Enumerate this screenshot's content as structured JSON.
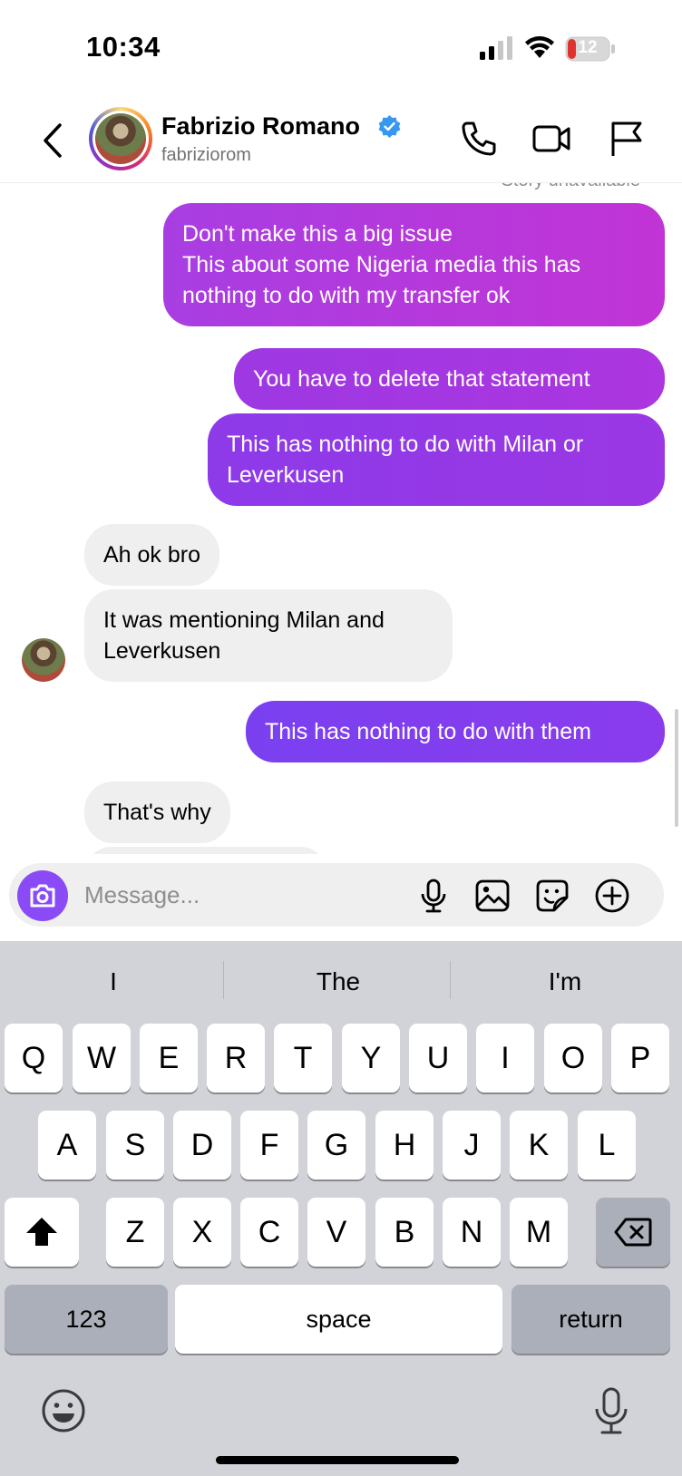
{
  "status": {
    "time": "10:34",
    "battery": "12"
  },
  "header": {
    "name": "Fabrizio Romano",
    "handle": "fabriziorom"
  },
  "chat": {
    "story_note": "Story unavailable",
    "messages": [
      {
        "from": "me",
        "text": "Don't make this a big issue\nThis about some Nigeria media this has nothing to do with my transfer ok",
        "color": "#b336dc"
      },
      {
        "from": "me",
        "text": "You have to delete that statement",
        "color": "#a535e0"
      },
      {
        "from": "me",
        "text": "This has nothing to do with Milan or Leverkusen",
        "color": "#9638e6"
      },
      {
        "from": "them",
        "text": "Ah ok bro"
      },
      {
        "from": "them",
        "text": "It was mentioning Milan and Leverkusen"
      },
      {
        "from": "me",
        "text": "This has nothing to do with them",
        "color": "#7b3ef0"
      },
      {
        "from": "them",
        "text": "That's why"
      }
    ]
  },
  "composer": {
    "placeholder": "Message..."
  },
  "keyboard": {
    "suggestions": [
      "I",
      "The",
      "I'm"
    ],
    "row1": [
      "Q",
      "W",
      "E",
      "R",
      "T",
      "Y",
      "U",
      "I",
      "O",
      "P"
    ],
    "row2": [
      "A",
      "S",
      "D",
      "F",
      "G",
      "H",
      "J",
      "K",
      "L"
    ],
    "row3": [
      "Z",
      "X",
      "C",
      "V",
      "B",
      "N",
      "M"
    ],
    "numbers_label": "123",
    "space_label": "space",
    "return_label": "return"
  },
  "colors": {
    "accent": "#8a4bf7",
    "verified": "#3897f0",
    "incoming_bubble": "#efefef"
  }
}
